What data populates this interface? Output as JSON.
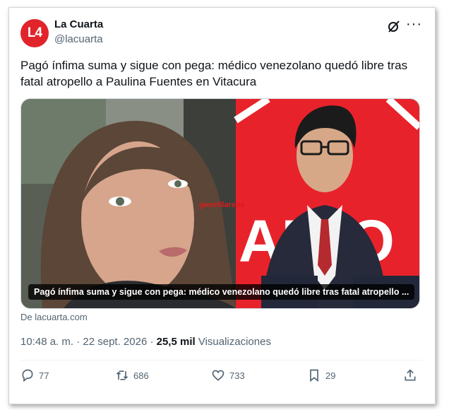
{
  "author": {
    "avatar_text": "L4",
    "name": "La Cuarta",
    "handle": "@lacuarta"
  },
  "icons": {
    "grok": "grok-icon",
    "more": "more-icon",
    "reply": "reply-icon",
    "retweet": "retweet-icon",
    "like": "heart-icon",
    "bookmark": "bookmark-icon",
    "share": "share-icon"
  },
  "post": {
    "text": "Pagó ínfima suma y sigue con pega: médico venezolano quedó libre tras fatal atropello a Paulina Fuentes en Vitacura"
  },
  "media": {
    "caption": "Pagó ínfima suma y sigue con pega: médico venezolano quedó libre tras fatal atropello ...",
    "watermark": "genefilarena",
    "sign_text": "ALTO",
    "source": "De lacuarta.com"
  },
  "meta": {
    "time_date": "10:48 a. m. · 22 sept. 2026 · ",
    "views_count": "25,5 mil",
    "views_label": " Visualizaciones"
  },
  "actions": {
    "replies": "77",
    "reposts": "686",
    "likes": "733",
    "bookmarks": "29"
  },
  "colors": {
    "brand_red": "#e1242b",
    "stop_sign_red": "#e8222b",
    "muted_text": "#536471"
  }
}
